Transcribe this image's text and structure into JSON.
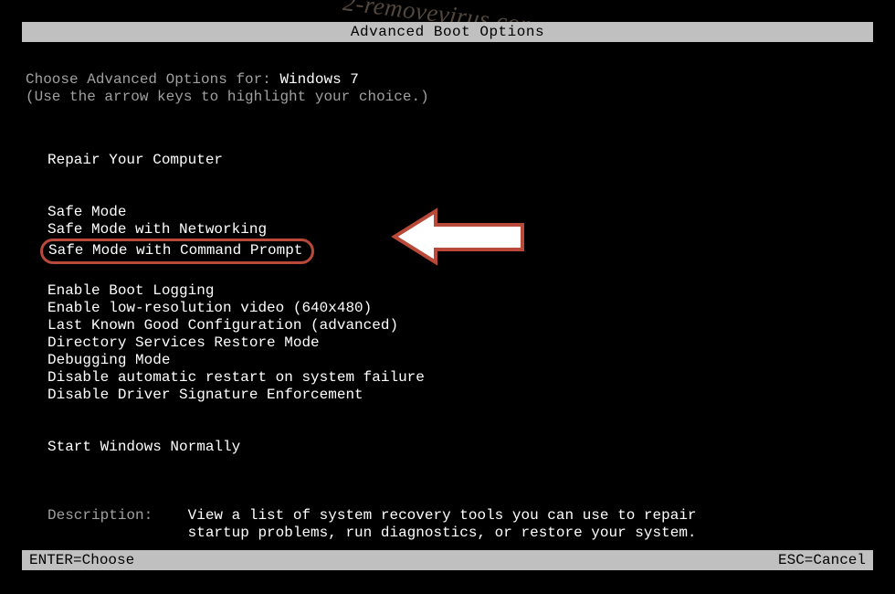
{
  "watermark": "2-removevirus.com",
  "title": "Advanced Boot Options",
  "header_line_prefix": "Choose Advanced Options for: ",
  "os_name": "Windows 7",
  "instruction": "(Use the arrow keys to highlight your choice.)",
  "menu": {
    "group1": [
      "Repair Your Computer"
    ],
    "group2": [
      "Safe Mode",
      "Safe Mode with Networking",
      "Safe Mode with Command Prompt"
    ],
    "group3": [
      "Enable Boot Logging",
      "Enable low-resolution video (640x480)",
      "Last Known Good Configuration (advanced)",
      "Directory Services Restore Mode",
      "Debugging Mode",
      "Disable automatic restart on system failure",
      "Disable Driver Signature Enforcement"
    ],
    "group4": [
      "Start Windows Normally"
    ]
  },
  "highlighted_index": 2,
  "description": {
    "label": "Description:    ",
    "text_line1": "View a list of system recovery tools you can use to repair",
    "text_line2": "startup problems, run diagnostics, or restore your system.",
    "indent": "                "
  },
  "footer": {
    "left": "ENTER=Choose",
    "right": "ESC=Cancel"
  }
}
